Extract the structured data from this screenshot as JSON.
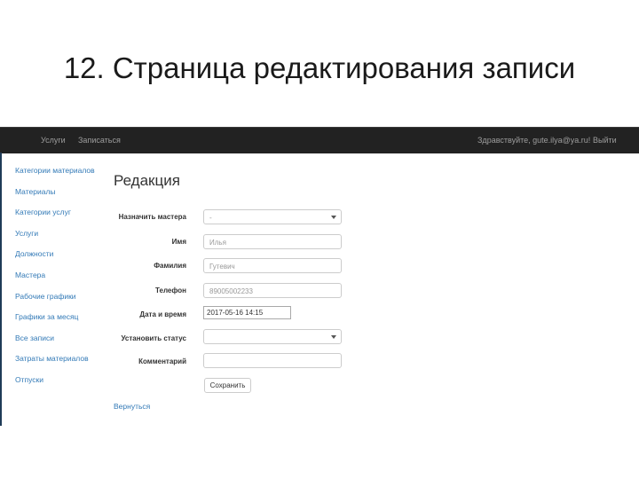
{
  "slide": {
    "title": "12. Страница редактирования записи"
  },
  "navbar": {
    "links": [
      "Услуги",
      "Записаться"
    ],
    "greeting": "Здравствуйте, gute.ilya@ya.ru!",
    "logout": "Выйти",
    "background": "#222222"
  },
  "sidebar": {
    "items": [
      "Категории материалов",
      "Материалы",
      "Категории услуг",
      "Услуги",
      "Должности",
      "Мастера",
      "Рабочие графики",
      "Графики за месяц",
      "Все записи",
      "Затраты материалов",
      "Отпуски"
    ],
    "link_color": "#337ab7"
  },
  "main": {
    "heading": "Редакция",
    "form": {
      "master": {
        "label": "Назначить мастера",
        "value": "-"
      },
      "first_name": {
        "label": "Имя",
        "value": "Илья"
      },
      "last_name": {
        "label": "Фамилия",
        "value": "Гутевич"
      },
      "phone": {
        "label": "Телефон",
        "value": "89005002233"
      },
      "datetime": {
        "label": "Дата и время",
        "value": "2017-05-16 14:15"
      },
      "status": {
        "label": "Установить статус",
        "value": ""
      },
      "comment": {
        "label": "Комментарий",
        "value": ""
      },
      "save_button": "Сохранить"
    },
    "back_link": "Вернуться"
  }
}
